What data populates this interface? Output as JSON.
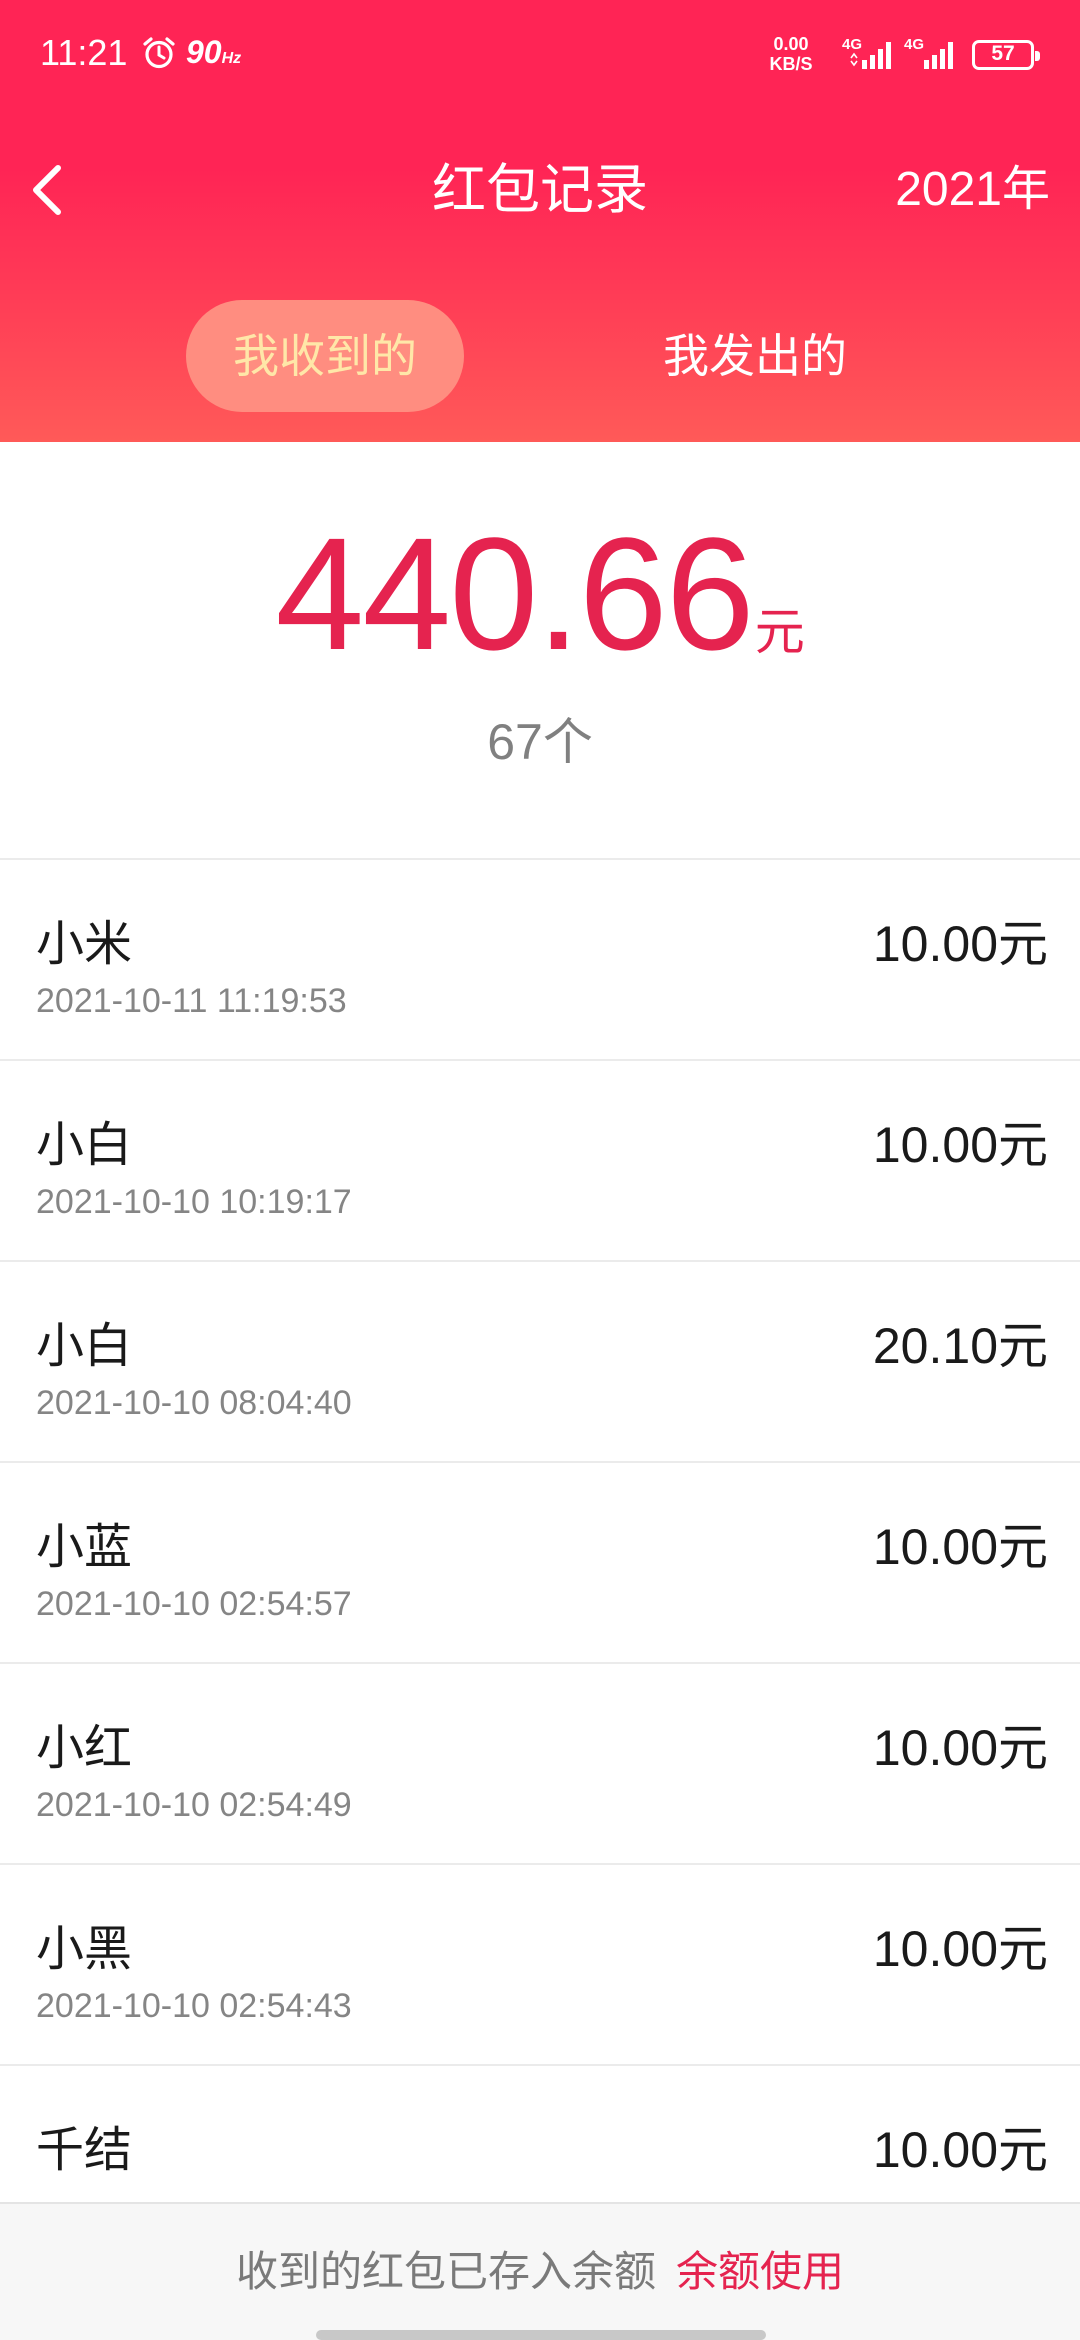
{
  "status_bar": {
    "time": "11:21",
    "refresh_rate": "90",
    "refresh_unit": "Hz",
    "net_speed_value": "0.00",
    "net_speed_unit": "KB/S",
    "sim1_label": "4G",
    "sim2_label": "4G",
    "battery": "57",
    "icons": [
      "alarm-icon",
      "signal-icon",
      "battery-icon"
    ]
  },
  "header": {
    "back_icon": "chevron-left-icon",
    "title": "红包记录",
    "year_selector": "2021年"
  },
  "tabs": [
    {
      "label": "我收到的",
      "selected": true
    },
    {
      "label": "我发出的",
      "selected": false
    }
  ],
  "summary": {
    "total_amount": "440.66",
    "total_unit": "元",
    "count": "67",
    "count_unit": "个"
  },
  "records": [
    {
      "name": "小米",
      "time": "2021-10-11 11:19:53",
      "amount": "10.00",
      "unit": "元"
    },
    {
      "name": "小白",
      "time": "2021-10-10 10:19:17",
      "amount": "10.00",
      "unit": "元"
    },
    {
      "name": "小白",
      "time": "2021-10-10 08:04:40",
      "amount": "20.10",
      "unit": "元"
    },
    {
      "name": "小蓝",
      "time": "2021-10-10 02:54:57",
      "amount": "10.00",
      "unit": "元"
    },
    {
      "name": "小红",
      "time": "2021-10-10 02:54:49",
      "amount": "10.00",
      "unit": "元"
    },
    {
      "name": "小黑",
      "time": "2021-10-10 02:54:43",
      "amount": "10.00",
      "unit": "元"
    },
    {
      "name": "千结",
      "time": "",
      "amount": "10.00",
      "unit": "元"
    }
  ],
  "footer": {
    "note": "收到的红包已存入余额",
    "link": "余额使用"
  },
  "colors": {
    "header_red": "#ff2455",
    "accent_red": "#e5234f",
    "tab_selected_bg": "#ff8d80",
    "tab_selected_text": "#ffe7a8"
  }
}
